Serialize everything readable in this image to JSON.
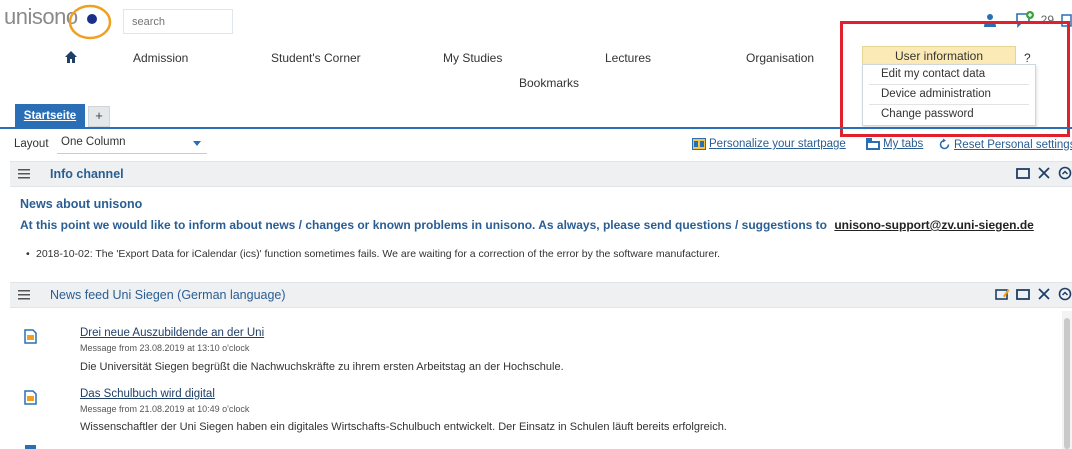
{
  "brand": {
    "logo_text": "unisono"
  },
  "header": {
    "search_placeholder": "search",
    "counter": "29"
  },
  "nav": {
    "items": [
      {
        "label": "Admission"
      },
      {
        "label": "Student's Corner"
      },
      {
        "label": "My Studies"
      },
      {
        "label": "Lectures"
      },
      {
        "label": "Organisation"
      }
    ],
    "bookmarks": "Bookmarks",
    "user_info": "User information",
    "help": "?"
  },
  "user_menu": {
    "items": [
      {
        "label": "Edit my contact data"
      },
      {
        "label": "Device administration"
      },
      {
        "label": "Change password"
      }
    ]
  },
  "tabs": {
    "active": "Startseite",
    "add": "+"
  },
  "toolbar": {
    "layout_label": "Layout",
    "layout_value": "One Column",
    "personalize": "Personalize your startpage",
    "my_tabs": "My tabs",
    "reset": "Reset Personal settings"
  },
  "info_channel": {
    "title": "Info channel",
    "news_title": "News about unisono",
    "info_text": "At this point we would like to inform about news / changes or known problems in unisono. As always, please send questions / suggestions to",
    "email": "unisono-support@zv.uni-siegen.de",
    "bullets": [
      "2018-10-02: The 'Export Data for iCalendar (ics)' function sometimes fails. We are waiting for a correction of the error by the software manufacturer."
    ]
  },
  "news_feed": {
    "title": "News feed Uni Siegen (German language)",
    "items": [
      {
        "title": "Drei neue Auszubildende an der Uni",
        "date": "Message from 23.08.2019 at 13:10 o'clock",
        "text": "Die Universität Siegen begrüßt die Nachwuchskräfte zu ihrem ersten Arbeitstag an der Hochschule."
      },
      {
        "title": "Das Schulbuch wird digital",
        "date": "Message from 21.08.2019 at 10:49 o'clock",
        "text": "Wissenschaftler der Uni Siegen haben ein digitales Wirtschafts-Schulbuch entwickelt. Der Einsatz in Schulen läuft bereits erfolgreich."
      }
    ]
  },
  "colors": {
    "accent_blue": "#2a6fb5",
    "link_blue": "#2a5e93",
    "highlight_red": "#e0202a",
    "user_info_bg": "#fbeab5",
    "logo_orange": "#f0a020"
  },
  "icons": [
    "home-icon",
    "person-icon",
    "chat-plus-icon",
    "hamburger-icon",
    "maximize-icon",
    "close-icon",
    "collapse-icon",
    "edit-icon",
    "rss-item-icon",
    "personalize-icon",
    "tabs-icon",
    "reset-icon",
    "caret-down-icon"
  ]
}
